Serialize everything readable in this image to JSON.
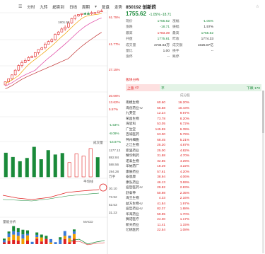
{
  "toolbar": {
    "items": [
      "分时",
      "九转",
      "超卖到",
      "日线",
      "周期",
      "复盘",
      "走势"
    ]
  },
  "chart": {
    "high_label": "1801.54",
    "price_axis": [
      "61.75%",
      "41.77%",
      "27.15%",
      "6.88%",
      "-5.76%",
      "-19.48%",
      "-26.54%",
      "3.90%",
      "-29.70%"
    ],
    "mid_axis": [
      "27.15%",
      "20.06%",
      "13.62%",
      "5.57%",
      "-1.53%",
      "-8.09%",
      "-16.97%"
    ],
    "vol_title": "成交量",
    "vol_axis": [
      "1177.12",
      "882.84",
      "588.56",
      "294.28",
      "万手"
    ],
    "mid2_title": "平均线",
    "macd_axis": [
      "30.10",
      "73.92",
      "52.53",
      "31.23"
    ],
    "macd_title": "MACD",
    "bottom_title": "量能分析"
  },
  "quote": {
    "code_name": "850192 创新药",
    "price": "1755.62",
    "change": "-1.05%  -18.71",
    "rows": [
      {
        "l1": "现价",
        "v1": "1755.62",
        "l2": "涨幅",
        "v2": "-1.05%",
        "c1": "green",
        "c2": "green"
      },
      {
        "l1": "涨跌",
        "v1": "-18.71",
        "l2": "振幅",
        "v2": "1.57%",
        "c1": "green",
        "c2": "dark"
      },
      {
        "l1": "最高",
        "v1": "1783.39",
        "l2": "最高",
        "v2": "1755.62",
        "c1": "red",
        "c2": "green"
      },
      {
        "l1": "开盘",
        "v1": "1775.81",
        "l2": "昨收",
        "v2": "1774.33",
        "c1": "green",
        "c2": "dark"
      },
      {
        "l1": "成交量",
        "v1": "4734.64万",
        "l2": "成交额",
        "v2": "1025.07亿",
        "c1": "dark",
        "c2": "dark"
      },
      {
        "l1": "量比",
        "v1": "1.00",
        "l2": "换手",
        "v2": "--",
        "c1": "dark",
        "c2": "dark"
      },
      {
        "l1": "涨停",
        "v1": "--",
        "l2": "跌停",
        "v2": "",
        "c1": "dark",
        "c2": "dark"
      }
    ]
  },
  "sector": {
    "title": "板块分布",
    "up_label": "上涨",
    "up_count": "42",
    "flat_label": "平",
    "down_label": "下跌",
    "down_count": "170",
    "sub": "成分股"
  },
  "members": [
    {
      "name": "南模生物",
      "price": "60.60",
      "chg": "16.20%"
    },
    {
      "name": "海创药业-U",
      "price": "66.58",
      "chg": "10.43%"
    },
    {
      "name": "九芙堂",
      "price": "12.24",
      "chg": "9.97%"
    },
    {
      "name": "荣昌生物",
      "price": "73.78",
      "chg": "8.20%"
    },
    {
      "name": "海思科",
      "price": "53.05",
      "chg": "6.72%"
    },
    {
      "name": "广生堂",
      "price": "145.59",
      "chg": "6.39%"
    },
    {
      "name": "百诚医药",
      "price": "63.00",
      "chg": "5.79%"
    },
    {
      "name": "神州细胞",
      "price": "68.45",
      "chg": "5.21%"
    },
    {
      "name": "之江生物",
      "price": "25.20",
      "chg": "4.87%"
    },
    {
      "name": "索里药业",
      "price": "25.00",
      "chg": "4.82%"
    },
    {
      "name": "精华制药",
      "price": "31.88",
      "chg": "4.70%"
    },
    {
      "name": "诺泰生物",
      "price": "32.85",
      "chg": "4.29%"
    },
    {
      "name": "华纳药厂",
      "price": "18.29",
      "chg": "4.22%"
    },
    {
      "name": "康辰药业",
      "price": "57.61",
      "chg": "4.20%"
    },
    {
      "name": "泰恩康",
      "price": "38.94",
      "chg": "4.06%"
    },
    {
      "name": "康弘药业",
      "price": "46.13",
      "chg": "3.69%"
    },
    {
      "name": "迪哲医药-U",
      "price": "29.82",
      "chg": "2.83%"
    },
    {
      "name": "舒泰神",
      "price": "50.98",
      "chg": "2.35%"
    },
    {
      "name": "海王生物",
      "price": "4.33",
      "chg": "2.16%"
    },
    {
      "name": "益方生物-U",
      "price": "41.84",
      "chg": "1.97%"
    },
    {
      "name": "迪哲药业-U",
      "price": "82.37",
      "chg": "1.88%"
    },
    {
      "name": "华海药业",
      "price": "59.95",
      "chg": "1.70%"
    },
    {
      "name": "赛诺医疗",
      "price": "24.30",
      "chg": "1.17%"
    },
    {
      "name": "新天药业",
      "price": "11.41",
      "chg": "1.15%"
    },
    {
      "name": "亿帆医药",
      "price": "22.54",
      "chg": "1.08%"
    }
  ]
}
